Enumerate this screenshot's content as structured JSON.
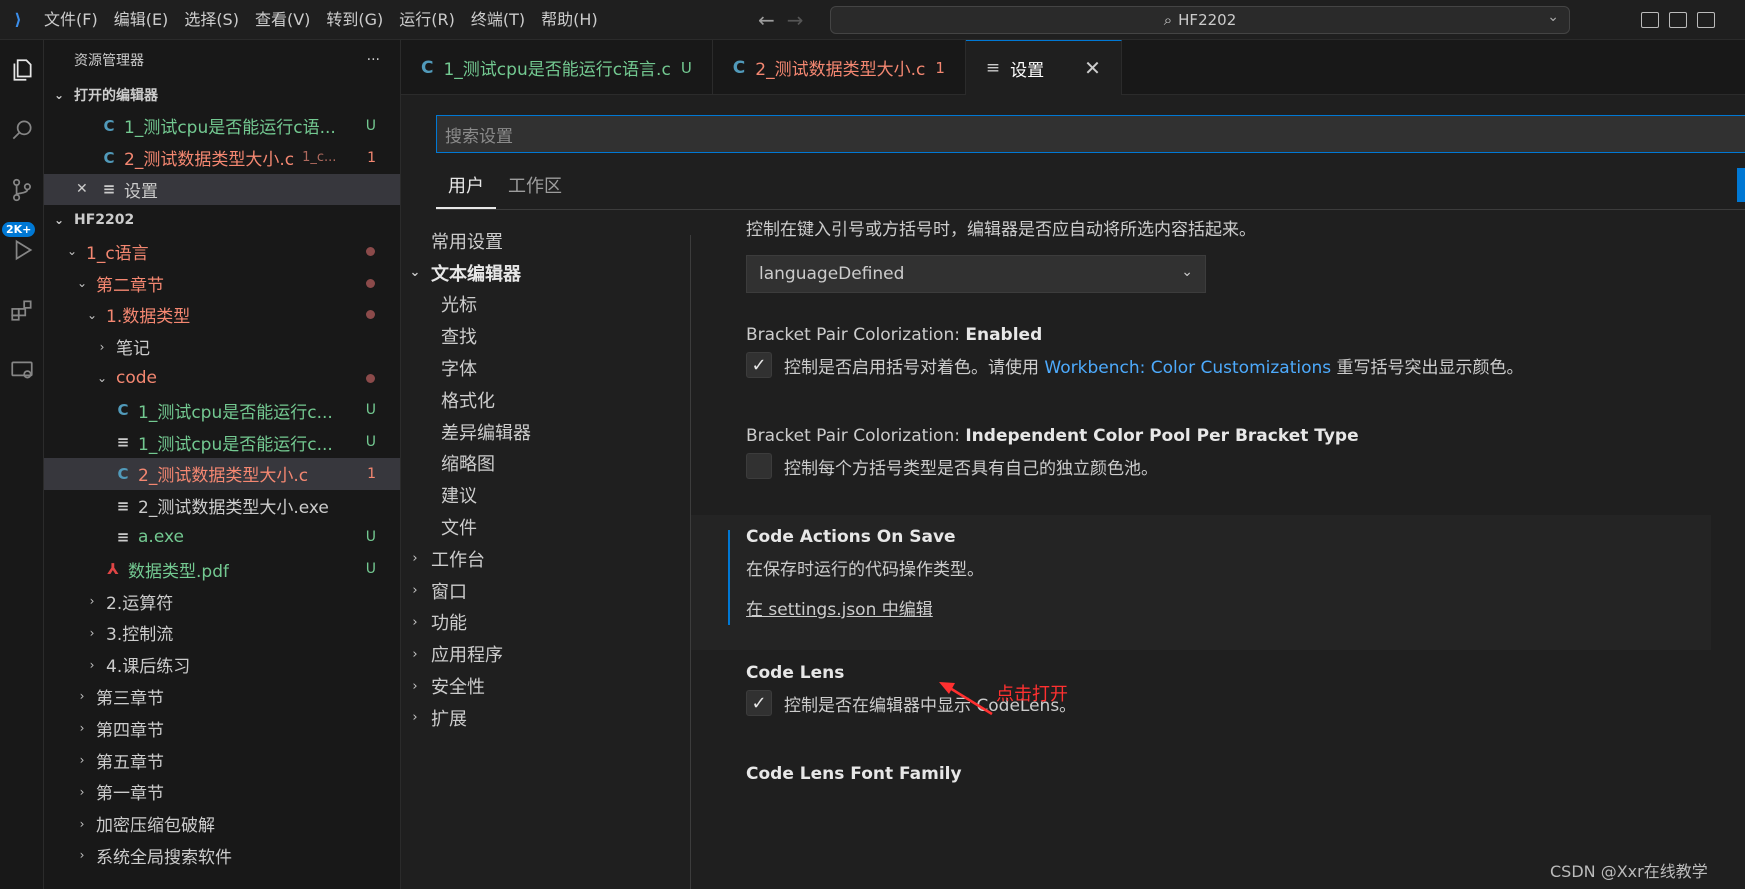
{
  "menu": [
    "文件(F)",
    "编辑(E)",
    "选择(S)",
    "查看(V)",
    "转到(G)",
    "运行(R)",
    "终端(T)",
    "帮助(H)"
  ],
  "command_center": {
    "text": "HF2202"
  },
  "activity_badge": "2K+",
  "sidebar": {
    "title": "资源管理器",
    "more": "···",
    "open_editors": {
      "header": "打开的编辑器",
      "items": [
        {
          "icon": "C",
          "label": "1_测试cpu是否能运行c语...",
          "deco": "U"
        },
        {
          "icon": "C",
          "label": "2_测试数据类型大小.c",
          "path": "1_c...",
          "deco": "1"
        },
        {
          "icon": "≡",
          "label": "设置",
          "close": "✕"
        }
      ]
    },
    "workspace": {
      "header": "HF2202",
      "tree": [
        {
          "label": "1_c语言"
        },
        {
          "label": "第二章节"
        },
        {
          "label": "1.数据类型"
        },
        {
          "label": "笔记"
        },
        {
          "label": "code"
        },
        {
          "icon": "C",
          "label": "1_测试cpu是否能运行c...",
          "deco": "U"
        },
        {
          "icon": "≡",
          "label": "1_测试cpu是否能运行c...",
          "deco": "U"
        },
        {
          "icon": "C",
          "label": "2_测试数据类型大小.c",
          "deco": "1"
        },
        {
          "icon": "≡",
          "label": "2_测试数据类型大小.exe"
        },
        {
          "icon": "≡",
          "label": "a.exe",
          "deco": "U"
        },
        {
          "icon": "⅄",
          "label": "数据类型.pdf",
          "deco": "U"
        },
        {
          "label": "2.运算符"
        },
        {
          "label": "3.控制流"
        },
        {
          "label": "4.课后练习"
        },
        {
          "label": "第三章节"
        },
        {
          "label": "第四章节"
        },
        {
          "label": "第五章节"
        },
        {
          "label": "第一章节"
        },
        {
          "label": "加密压缩包破解"
        },
        {
          "label": "系统全局搜索软件"
        }
      ]
    }
  },
  "tabs": [
    {
      "icon": "C",
      "label": "1_测试cpu是否能运行c语言.c",
      "deco": "U"
    },
    {
      "icon": "C",
      "label": "2_测试数据类型大小.c",
      "deco": "1"
    },
    {
      "icon": "≡",
      "label": "设置",
      "close": "✕"
    }
  ],
  "settings": {
    "search_placeholder": "搜索设置",
    "scopes": [
      "用户",
      "工作区"
    ],
    "toc": [
      {
        "label": "常用设置"
      },
      {
        "label": "文本编辑器"
      },
      {
        "label": "光标"
      },
      {
        "label": "查找"
      },
      {
        "label": "字体"
      },
      {
        "label": "格式化"
      },
      {
        "label": "差异编辑器"
      },
      {
        "label": "缩略图"
      },
      {
        "label": "建议"
      },
      {
        "label": "文件"
      },
      {
        "label": "工作台"
      },
      {
        "label": "窗口"
      },
      {
        "label": "功能"
      },
      {
        "label": "应用程序"
      },
      {
        "label": "安全性"
      },
      {
        "label": "扩展"
      }
    ],
    "items": {
      "auto_surround_desc": "控制在键入引号或方括号时，编辑器是否应自动将所选内容括起来。",
      "auto_surround_value": "languageDefined",
      "bpc_enabled_prefix": "Bracket Pair Colorization: ",
      "bpc_enabled_name": "Enabled",
      "bpc_enabled_desc_pre": "控制是否启用括号对着色。请使用 ",
      "bpc_enabled_link": "Workbench: Color Customizations",
      "bpc_enabled_desc_post": " 重写括号突出显示颜色。",
      "bpc_pool_prefix": "Bracket Pair Colorization: ",
      "bpc_pool_name": "Independent Color Pool Per Bracket Type",
      "bpc_pool_desc": "控制每个方括号类型是否具有自己的独立颜色池。",
      "cas_title": "Code Actions On Save",
      "cas_desc": "在保存时运行的代码操作类型。",
      "cas_link": "在 settings.json 中编辑",
      "codelens_title": "Code Lens",
      "codelens_desc": "控制是否在编辑器中显示 CodeLens。",
      "codelens_font_title": "Code Lens Font Family"
    }
  },
  "annotation": "点击打开",
  "watermark": "CSDN @Xxr在线教学",
  "colors": {
    "accent": "#0078d4",
    "untracked": "#73c991",
    "error": "#f48771",
    "link": "#4daafc",
    "annotation": "#ff3030"
  }
}
